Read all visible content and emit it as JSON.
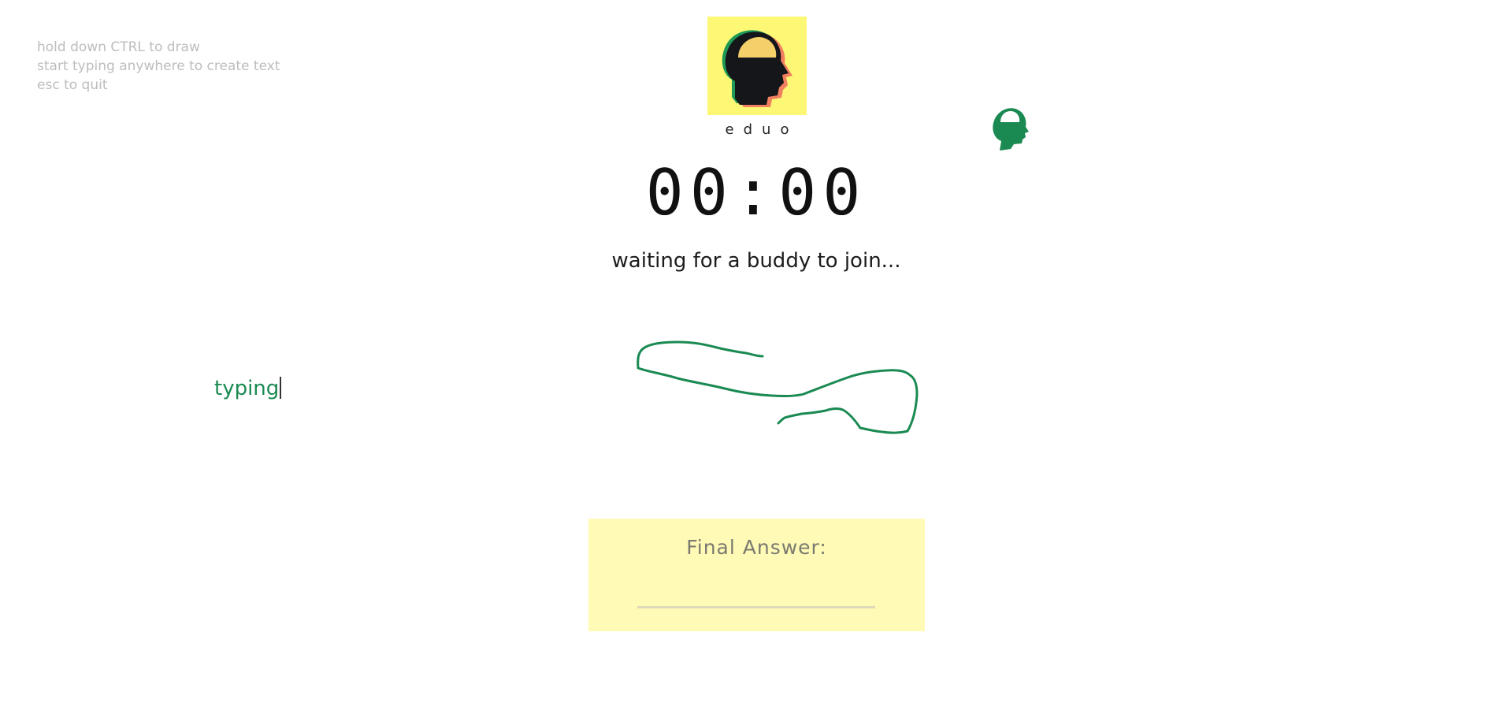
{
  "instructions": [
    "hold down CTRL to draw",
    "start typing anywhere to create text",
    "esc to quit"
  ],
  "logo": {
    "name": "eduo",
    "icon": "head-silhouette-icon",
    "background": "#fdf776"
  },
  "buddy": {
    "icon": "head-silhouette-icon",
    "color": "#1a8a52"
  },
  "timer": {
    "display": "00:00"
  },
  "status": {
    "message": "waiting for a buddy to join..."
  },
  "canvas": {
    "typed_text": "typing",
    "stroke_color": "#1a8a52"
  },
  "final_answer": {
    "label": "Final Answer:",
    "value": "",
    "background": "#fffab5"
  }
}
